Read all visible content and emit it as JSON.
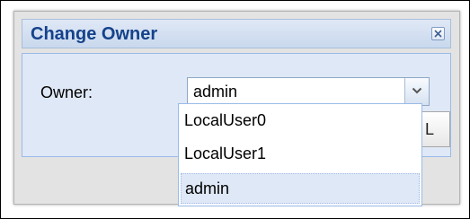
{
  "dialog": {
    "title": "Change Owner",
    "close_icon": "close-icon"
  },
  "form": {
    "owner_label": "Owner:",
    "owner_value": "admin",
    "trigger_icon": "chevron-down-icon"
  },
  "dropdown": {
    "items": [
      {
        "label": "LocalUser0",
        "selected": false
      },
      {
        "label": "LocalUser1",
        "selected": false
      },
      {
        "label": "admin",
        "selected": true
      }
    ]
  },
  "button": {
    "visible_text": "L"
  },
  "colors": {
    "title_text": "#15428b",
    "panel_bg": "#dfe8f6",
    "selected_bg": "#dfe8f6",
    "border_blue": "#99bbe8"
  }
}
